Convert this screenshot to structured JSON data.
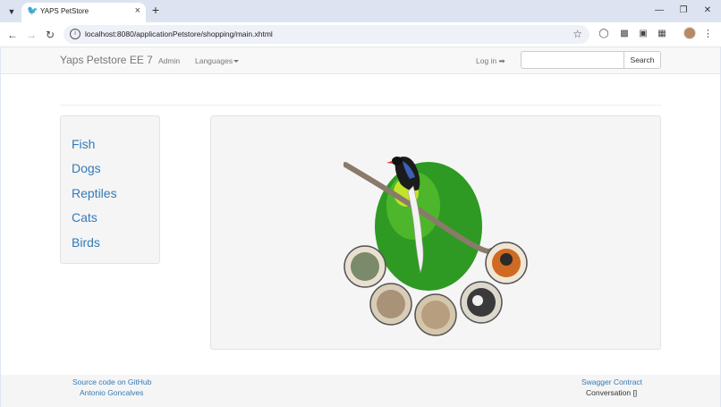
{
  "browser": {
    "tab_title": "YAPS PetStore",
    "url": "localhost:8080/applicationPetstore/shopping/main.xhtml"
  },
  "navbar": {
    "brand": "Yaps Petstore EE 7",
    "admin": "Admin",
    "languages": "Languages",
    "login": "Log in",
    "search_value": "",
    "search_button": "Search"
  },
  "categories": [
    "Fish",
    "Dogs",
    "Reptiles",
    "Cats",
    "Birds"
  ],
  "footer": {
    "source_code": "Source code on GitHub",
    "author": "Antonio Goncalves",
    "swagger": "Swagger Contract",
    "conversation": "Conversation []"
  },
  "colors": {
    "link": "#337ab7",
    "navbar_bg": "#f8f8f8",
    "well_bg": "#f5f5f5"
  }
}
